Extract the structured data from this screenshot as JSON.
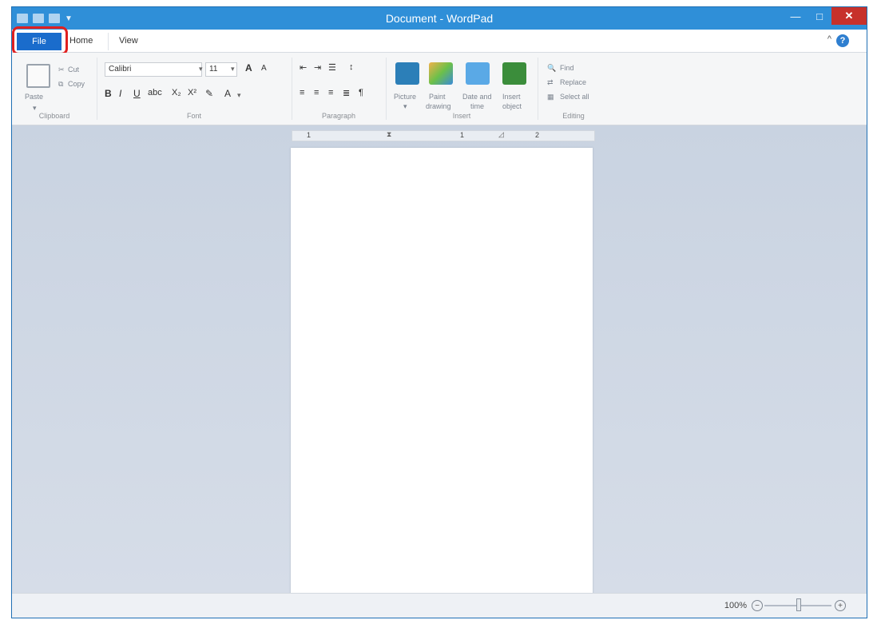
{
  "window": {
    "title": "Document - WordPad"
  },
  "tabs": {
    "file": "File",
    "home": "Home",
    "view": "View"
  },
  "ribbon": {
    "clipboard": {
      "paste": "Paste",
      "cut": "Cut",
      "copy": "Copy",
      "label": "Clipboard"
    },
    "font": {
      "name": "Calibri",
      "size": "11",
      "label": "Font"
    },
    "paragraph": {
      "label": "Paragraph"
    },
    "insert": {
      "picture": "Picture",
      "paint_drawing_1": "Paint",
      "paint_drawing_2": "drawing",
      "date_time_1": "Date and",
      "date_time_2": "time",
      "insert_object_1": "Insert",
      "insert_object_2": "object",
      "label": "Insert"
    },
    "editing": {
      "find": "Find",
      "replace": "Replace",
      "select_all": "Select all",
      "label": "Editing"
    }
  },
  "ruler": {
    "n1": "1",
    "n2": "1",
    "n3": "2"
  },
  "status": {
    "zoom": "100%"
  }
}
